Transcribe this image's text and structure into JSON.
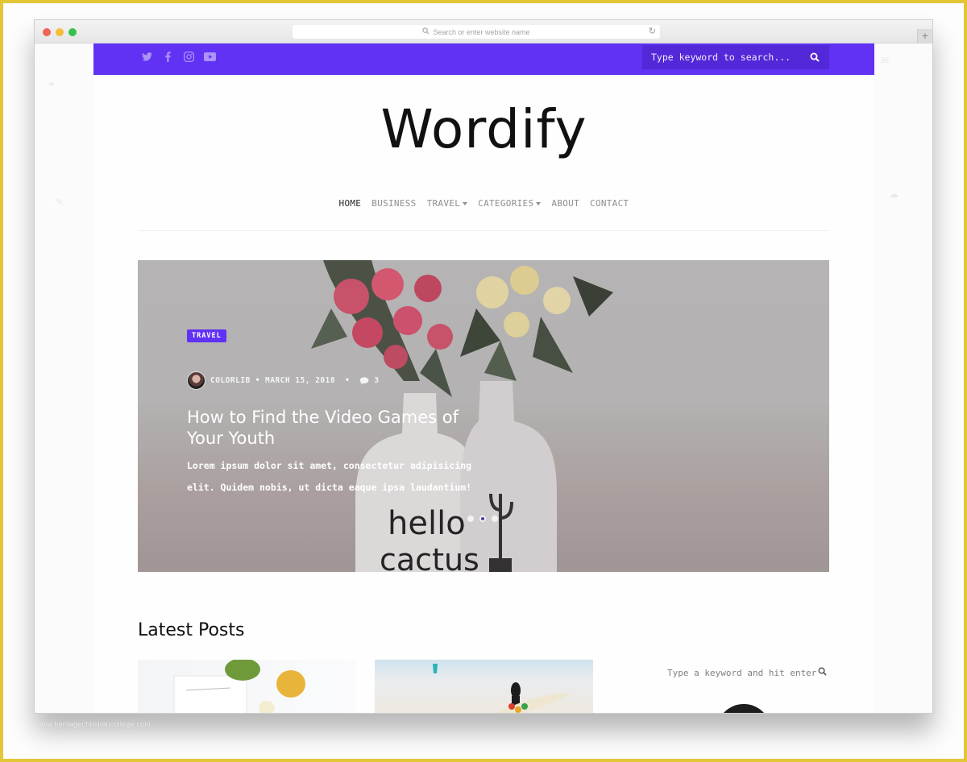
{
  "browser": {
    "address_placeholder": "Search or enter website name",
    "new_tab_label": "+"
  },
  "topbar": {
    "social": [
      "twitter-icon",
      "facebook-icon",
      "instagram-icon",
      "youtube-icon"
    ],
    "search_placeholder": "Type keyword to search...",
    "accent_color": "#6131f4"
  },
  "site": {
    "logo": "Wordify"
  },
  "nav": {
    "items": [
      {
        "label": "HOME",
        "active": true,
        "dropdown": false
      },
      {
        "label": "BUSINESS",
        "active": false,
        "dropdown": false
      },
      {
        "label": "TRAVEL",
        "active": false,
        "dropdown": true
      },
      {
        "label": "CATEGORIES",
        "active": false,
        "dropdown": true
      },
      {
        "label": "ABOUT",
        "active": false,
        "dropdown": false
      },
      {
        "label": "CONTACT",
        "active": false,
        "dropdown": false
      }
    ]
  },
  "hero": {
    "category": "TRAVEL",
    "author": "COLORLIB",
    "separator": "•",
    "date": "MARCH 15, 2018",
    "comments": "3",
    "title": "How to Find the Video Games of Your Youth",
    "excerpt": "Lorem ipsum dolor sit amet, consectetur adipisicing elit. Quidem nobis, ut dicta eaque ipsa laudantium!",
    "slides": 3,
    "active_slide": 2,
    "vase_text_1": "hello",
    "vase_text_2": "cactus"
  },
  "latest": {
    "title": "Latest Posts"
  },
  "sidebar": {
    "search_placeholder": "Type a keyword and hit enter"
  },
  "watermark": "www.heritagechristiancollege.com"
}
